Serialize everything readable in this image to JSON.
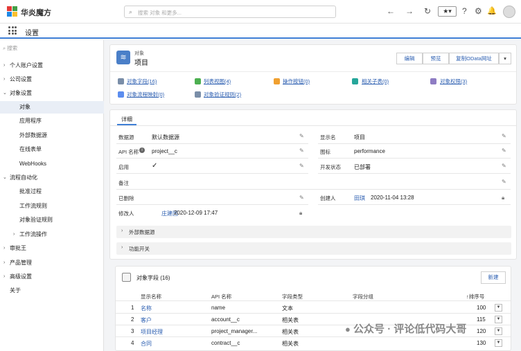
{
  "app": {
    "name": "华炎魔方",
    "search_placeholder": "搜索 对象 和更多...",
    "subtitle": "设置",
    "fav_label": "★▾"
  },
  "sidebar": {
    "search_placeholder": "搜索",
    "items": [
      {
        "label": "个人账户设置"
      },
      {
        "label": "公司设置"
      },
      {
        "label": "对象设置"
      },
      {
        "label": "对象"
      },
      {
        "label": "应用程序"
      },
      {
        "label": "外部数据源"
      },
      {
        "label": "在线表单"
      },
      {
        "label": "WebHooks"
      },
      {
        "label": "流程自动化"
      },
      {
        "label": "批准过程"
      },
      {
        "label": "工作流规则"
      },
      {
        "label": "对象验证规则"
      },
      {
        "label": "工作流操作"
      },
      {
        "label": "审批王"
      },
      {
        "label": "产品管理"
      },
      {
        "label": "高级设置"
      },
      {
        "label": "关于"
      }
    ]
  },
  "header": {
    "type_label": "对象",
    "title": "项目",
    "buttons": [
      "编辑",
      "预览",
      "复制OData网址"
    ]
  },
  "quick_links": [
    {
      "label": "对象字段(16)",
      "color": "#7a8ea8"
    },
    {
      "label": "列表视图(4)",
      "color": "#4caf50"
    },
    {
      "label": "操作按钮(0)",
      "color": "#f0a030"
    },
    {
      "label": "相关子表(0)",
      "color": "#26a69a"
    },
    {
      "label": "对象权限(3)",
      "color": "#8e7cc3"
    },
    {
      "label": "对象流程映射(0)",
      "color": "#5b8def"
    },
    {
      "label": "对象验证规则(2)",
      "color": "#7a8ea8"
    }
  ],
  "detail": {
    "tab": "详细",
    "fields": {
      "datasource_label": "数据源",
      "datasource": "默认数据源",
      "display_label": "显示名",
      "display": "项目",
      "api_label": "API 名称",
      "api": "project__c",
      "icon_label": "图标",
      "icon": "performance",
      "enabled_label": "启用",
      "enabled": "✓",
      "dev_label": "开发状态",
      "dev": "已部署",
      "remark_label": "备注",
      "deleted_label": "已删除",
      "creator_label": "创建人",
      "creator": "田琪",
      "created": "2020-11-04 13:28",
      "modifier_label": "修改人",
      "modifier": "庄建国",
      "modified": "2020-12-09 17:47"
    },
    "sections": [
      "外部数据源",
      "功能开关"
    ]
  },
  "fields_table": {
    "title": "对象字段 (16)",
    "new_button": "新建",
    "headers": [
      "显示名称",
      "API 名称",
      "字段类型",
      "字段分组",
      "↑排序号"
    ],
    "rows": [
      {
        "no": "1",
        "name": "名称",
        "api": "name",
        "type": "文本",
        "group": "",
        "sort": "100"
      },
      {
        "no": "2",
        "name": "客户",
        "api": "account__c",
        "type": "相关表",
        "group": "",
        "sort": "115"
      },
      {
        "no": "3",
        "name": "项目经理",
        "api": "project_manager...",
        "type": "相关表",
        "group": "",
        "sort": "120"
      },
      {
        "no": "4",
        "name": "合同",
        "api": "contract__c",
        "type": "相关表",
        "group": "",
        "sort": "130"
      }
    ]
  },
  "watermark": "公众号 · 评论低代码大哥"
}
